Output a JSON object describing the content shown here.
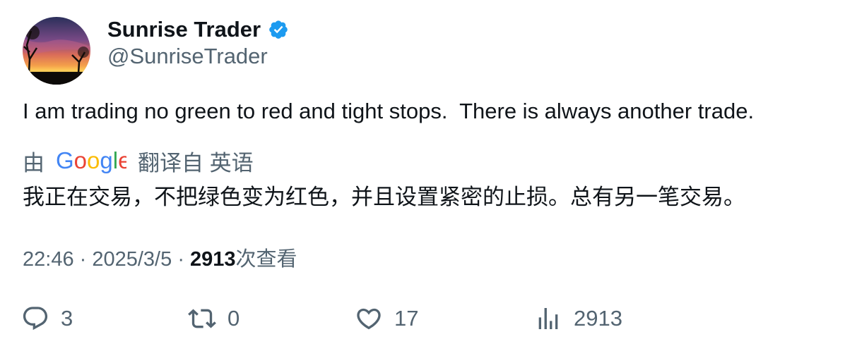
{
  "author": {
    "display_name": "Sunrise Trader",
    "handle": "@SunriseTrader",
    "verified_icon": "verified-badge-icon",
    "verified_color": "#1d9bf0"
  },
  "tweet": {
    "text": "I am trading no green to red and tight stops.  There is always another trade."
  },
  "translation": {
    "prefix": "由",
    "provider": "Google",
    "suffix": "翻译自 英语",
    "text": "我正在交易，不把绿色变为红色，并且设置紧密的止损。总有另一笔交易。"
  },
  "meta": {
    "time": "22:46",
    "separator": "·",
    "date": "2025/3/5",
    "views_count": "2913",
    "views_label": "次查看"
  },
  "actions": {
    "reply": {
      "icon": "reply-icon",
      "count": "3"
    },
    "retweet": {
      "icon": "retweet-icon",
      "count": "0"
    },
    "like": {
      "icon": "heart-icon",
      "count": "17"
    },
    "views": {
      "icon": "analytics-icon",
      "count": "2913"
    }
  },
  "colors": {
    "text_primary": "#0f1419",
    "text_secondary": "#536471",
    "accent": "#1d9bf0"
  }
}
